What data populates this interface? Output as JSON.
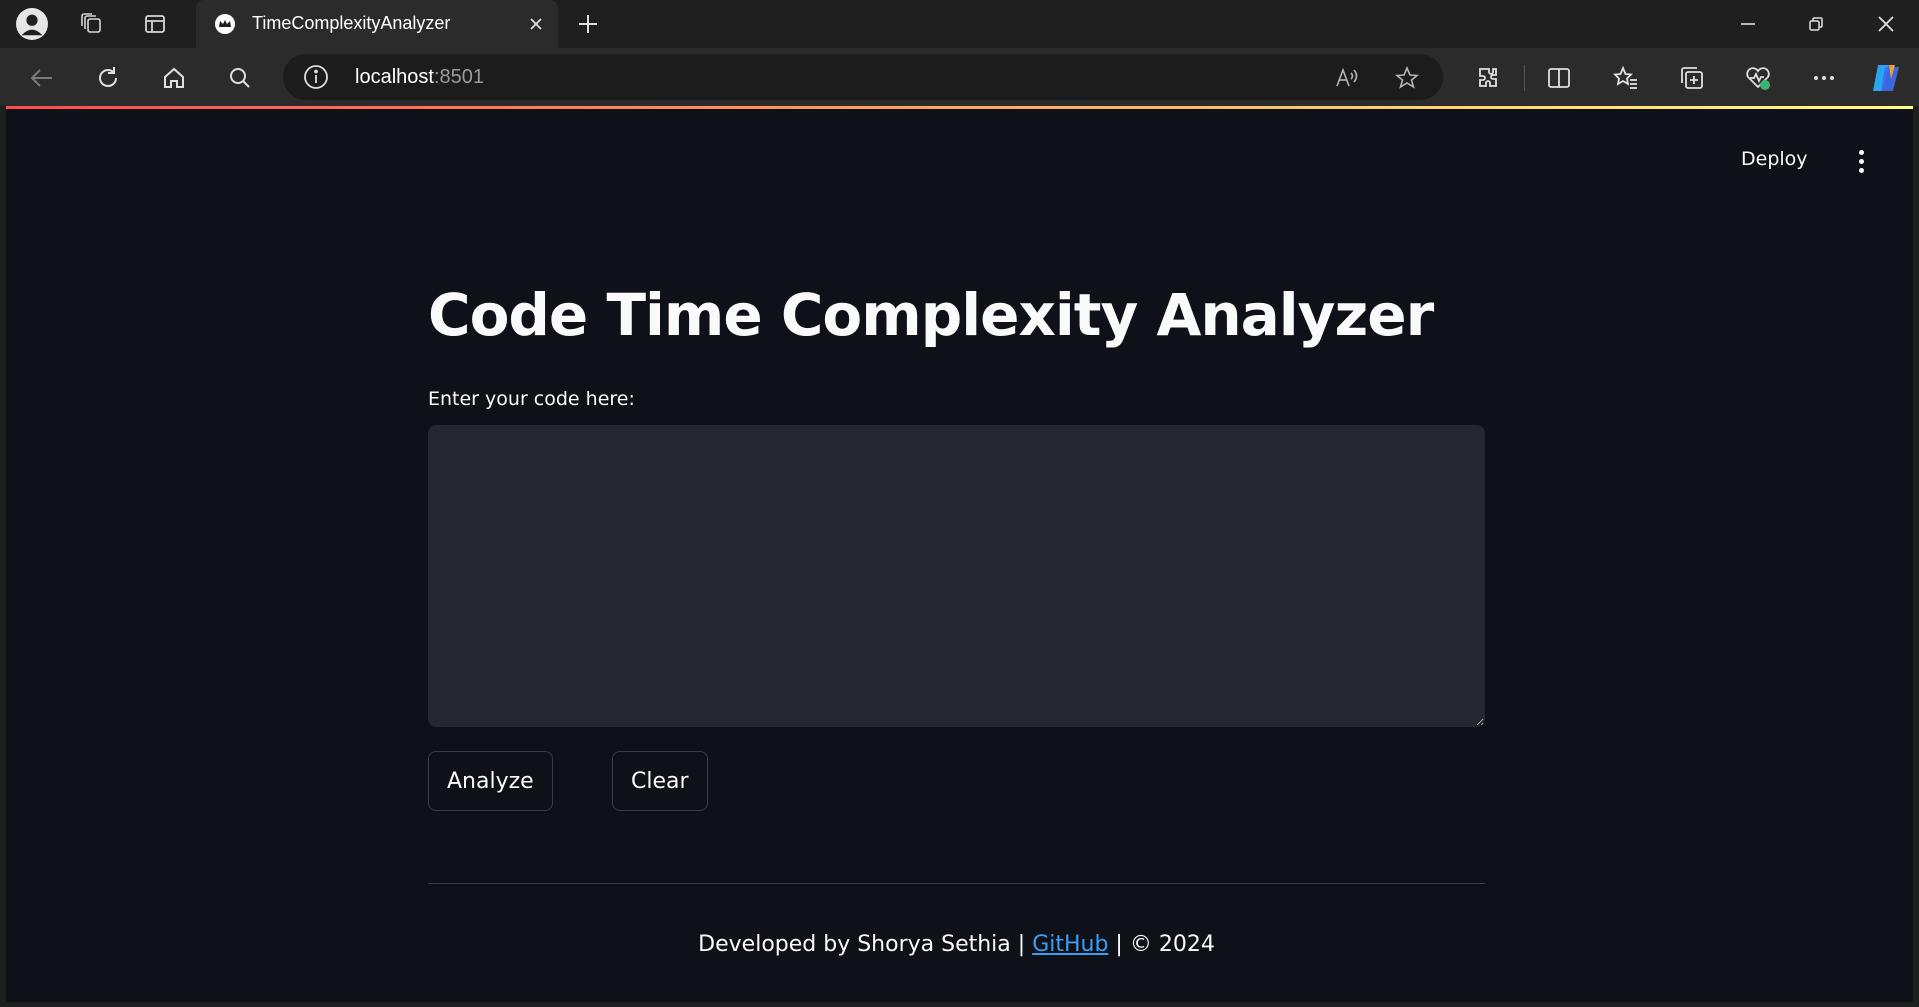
{
  "browser": {
    "tab": {
      "title": "TimeComplexityAnalyzer"
    },
    "address": {
      "host": "localhost",
      "port": ":8501"
    }
  },
  "app": {
    "header": {
      "deploy_label": "Deploy"
    },
    "title": "Code Time Complexity Analyzer",
    "code_input": {
      "label": "Enter your code here:",
      "value": "",
      "placeholder": ""
    },
    "buttons": {
      "analyze": "Analyze",
      "clear": "Clear"
    },
    "footer": {
      "prefix": "Developed by Shorya Sethia | ",
      "link": "GitHub",
      "suffix": " | © 2024"
    }
  },
  "colors": {
    "app_background": "#0e1117",
    "input_background": "#262730",
    "link": "#3d9df3",
    "accent_gradient_start": "#ff4b4b",
    "accent_gradient_end": "#fffd80"
  }
}
